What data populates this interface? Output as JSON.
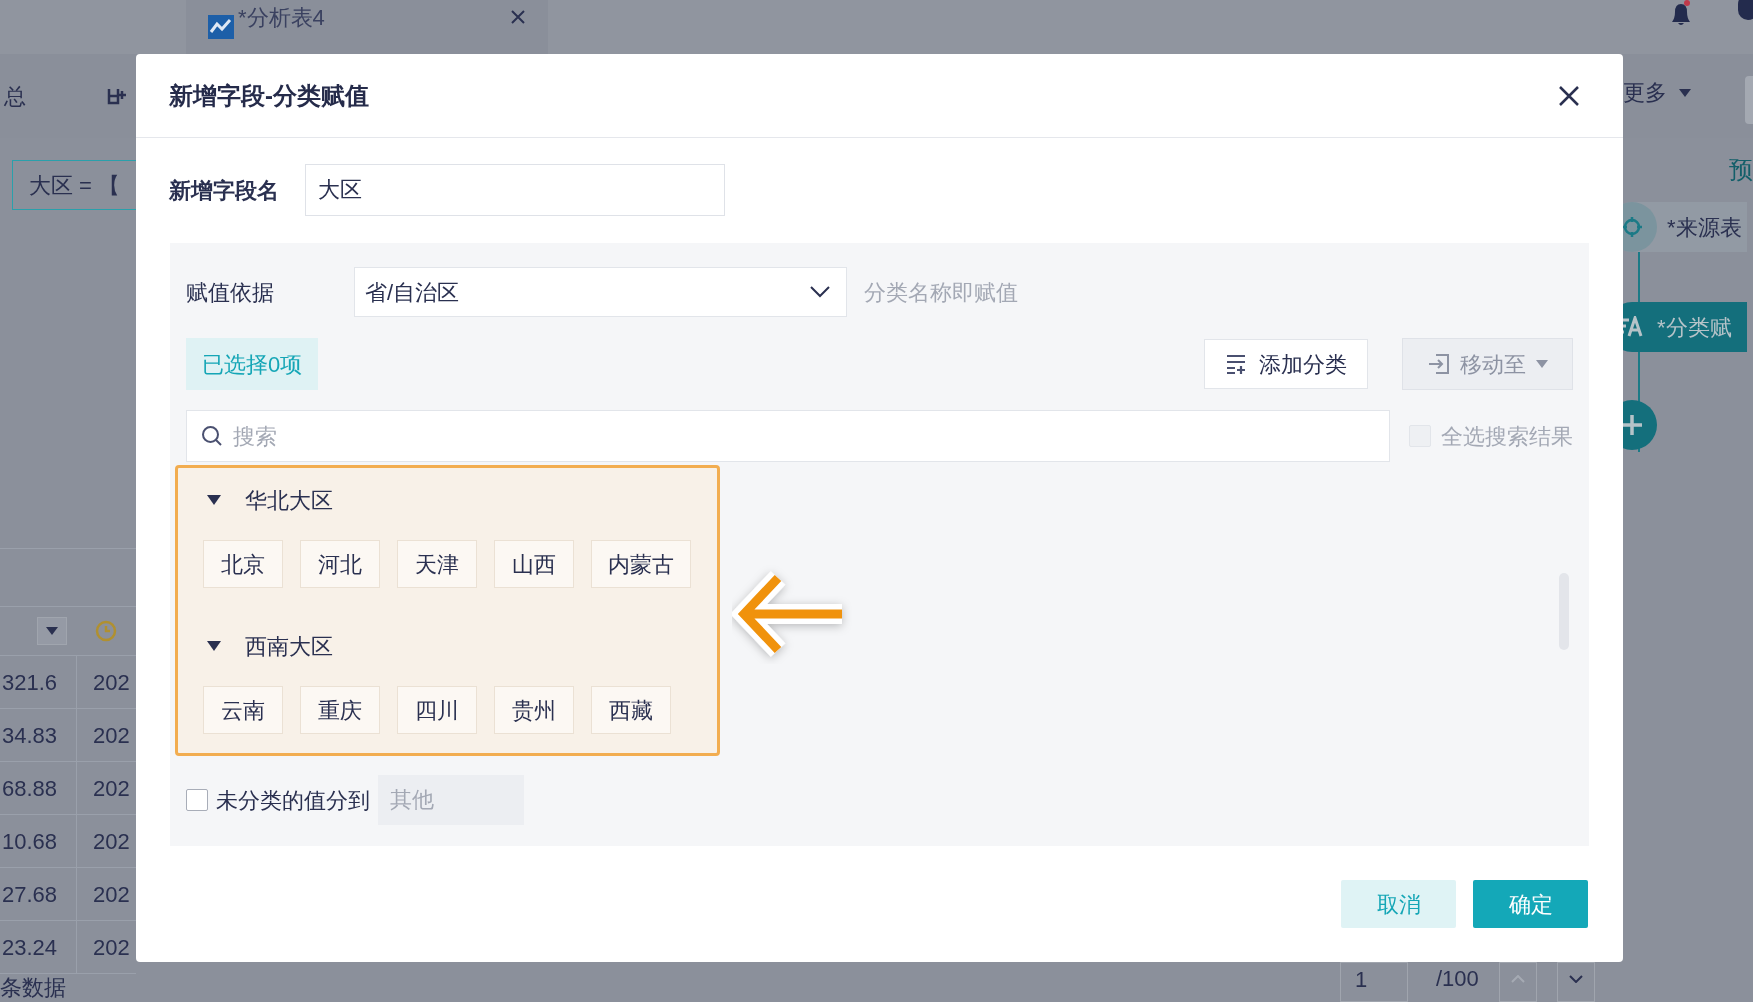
{
  "background": {
    "tab": {
      "title": "*分析表4"
    },
    "toolbar": {
      "label": "总",
      "more": "更多"
    },
    "filter_chip": "大区 = 【",
    "flow": {
      "preview": "预",
      "nodes": [
        {
          "label": "*来源表",
          "kind": "source"
        },
        {
          "label": "*分类赋",
          "kind": "step"
        },
        {
          "kind": "add"
        }
      ]
    },
    "table": {
      "rows": [
        {
          "column_1": "321.6",
          "column_2": "202"
        },
        {
          "column_1": "34.83",
          "column_2": "202"
        },
        {
          "column_1": "68.88",
          "column_2": "202"
        },
        {
          "column_1": "10.68",
          "column_2": "202"
        },
        {
          "column_1": "27.68",
          "column_2": "202"
        },
        {
          "column_1": "23.24",
          "column_2": "202"
        }
      ]
    },
    "footer": "条数据",
    "pagination": {
      "page": "1",
      "total": "/100"
    }
  },
  "dialog": {
    "title": "新增字段-分类赋值",
    "field_name": {
      "label": "新增字段名",
      "value": "大区"
    },
    "basis": {
      "label": "赋值依据",
      "value": "省/自治区",
      "hint": "分类名称即赋值"
    },
    "selected_count": "已选择0项",
    "add_category": "添加分类",
    "move_to": {
      "label": "移动至",
      "disabled": true
    },
    "search": {
      "placeholder": "搜索"
    },
    "select_all": {
      "label": "全选搜索结果",
      "checked": false,
      "disabled": true
    },
    "groups": [
      {
        "name": "华北大区",
        "expanded": true,
        "items": [
          "北京",
          "河北",
          "天津",
          "山西",
          "内蒙古"
        ]
      },
      {
        "name": "西南大区",
        "expanded": true,
        "items": [
          "云南",
          "重庆",
          "四川",
          "贵州",
          "西藏"
        ]
      }
    ],
    "unclassified": {
      "label": "未分类的值分到",
      "checked": false,
      "placeholder": "其他"
    },
    "footer_buttons": [
      {
        "label": "取消",
        "kind": "secondary"
      },
      {
        "label": "确定",
        "kind": "primary"
      }
    ]
  }
}
